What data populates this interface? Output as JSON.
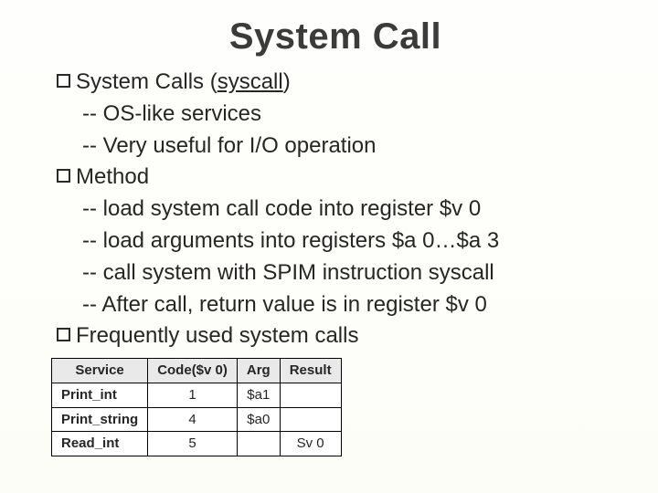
{
  "title": "System Call",
  "b1": {
    "lead": "System Calls (",
    "link": "syscall",
    "tail": ")"
  },
  "b1s1": "-- OS-like services",
  "b1s2": "-- Very useful for I/O operation",
  "b2": "Method",
  "b2s1_a": "-- load system call code into register ",
  "b2s1_b": "$v 0",
  "b2s2_a": "-- load arguments into registers ",
  "b2s2_b": "$a 0…$a 3",
  "b2s3_a": "-- call system with SPIM instruction ",
  "b2s3_b": "syscall",
  "b2s4_a": "-- After call, return value is in register ",
  "b2s4_b": "$v 0",
  "b3": "Frequently used system calls",
  "table": {
    "headers": [
      "Service",
      "Code($v 0)",
      "Arg",
      "Result"
    ],
    "rows": [
      [
        "Print_int",
        "1",
        "$a1",
        ""
      ],
      [
        "Print_string",
        "4",
        "$a0",
        ""
      ],
      [
        "Read_int",
        "5",
        "",
        "Sv 0"
      ]
    ]
  }
}
